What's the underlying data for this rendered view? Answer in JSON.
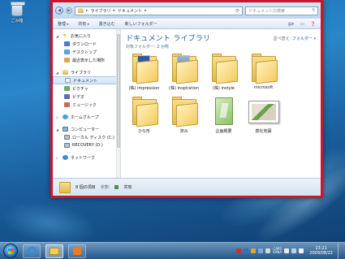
{
  "desktop": {
    "recycle_bin_label": "ごみ箱"
  },
  "address": {
    "crumbs": [
      "ライブラリ",
      "ドキュメント"
    ],
    "search_placeholder": "ドキュメントの検索"
  },
  "toolbar": {
    "organize": "整理",
    "share": "共有",
    "burn": "書き込む",
    "new_folder": "新しいフォルダー"
  },
  "nav": {
    "favorites": "お気に入り",
    "downloads": "ダウンロード",
    "desktop": "デスクトップ",
    "recent": "最近表示した場所",
    "libraries": "ライブラリ",
    "documents": "ドキュメント",
    "pictures": "ピクチャ",
    "videos": "ビデオ",
    "music": "ミュージック",
    "homegroup": "ホームグループ",
    "computer": "コンピューター",
    "local_disk": "ローカル ディスク (C:)",
    "recovery": "RECOVERY (D:)",
    "network": "ネットワーク"
  },
  "library": {
    "title": "ドキュメント ライブラリ",
    "subtitle_prefix": "対象フォルダー:",
    "subtitle_count": "2 か所",
    "arrange_prefix": "並べ替え:",
    "arrange_value": "フォルダー"
  },
  "items": [
    {
      "label": "(株) impression",
      "icon": "folder-icon"
    },
    {
      "label": "(株) inspiration",
      "icon": "folder-icon"
    },
    {
      "label": "(株) instyle",
      "icon": "folder-icon"
    },
    {
      "label": "microsoft",
      "icon": "folder-icon"
    },
    {
      "label": "ひな形",
      "icon": "folder-icon"
    },
    {
      "label": "済み",
      "icon": "folder-icon"
    },
    {
      "label": "企画概要",
      "icon": "document-icon"
    },
    {
      "label": "弊社地図",
      "icon": "image-icon"
    }
  ],
  "details": {
    "count": "8 個の項目",
    "status_label": "状態:",
    "status_value": "共有"
  },
  "taskbar": {
    "ime_line1": "CAPS",
    "ime_line2": "KANA",
    "time": "13:21",
    "date": "2009/08/22"
  }
}
